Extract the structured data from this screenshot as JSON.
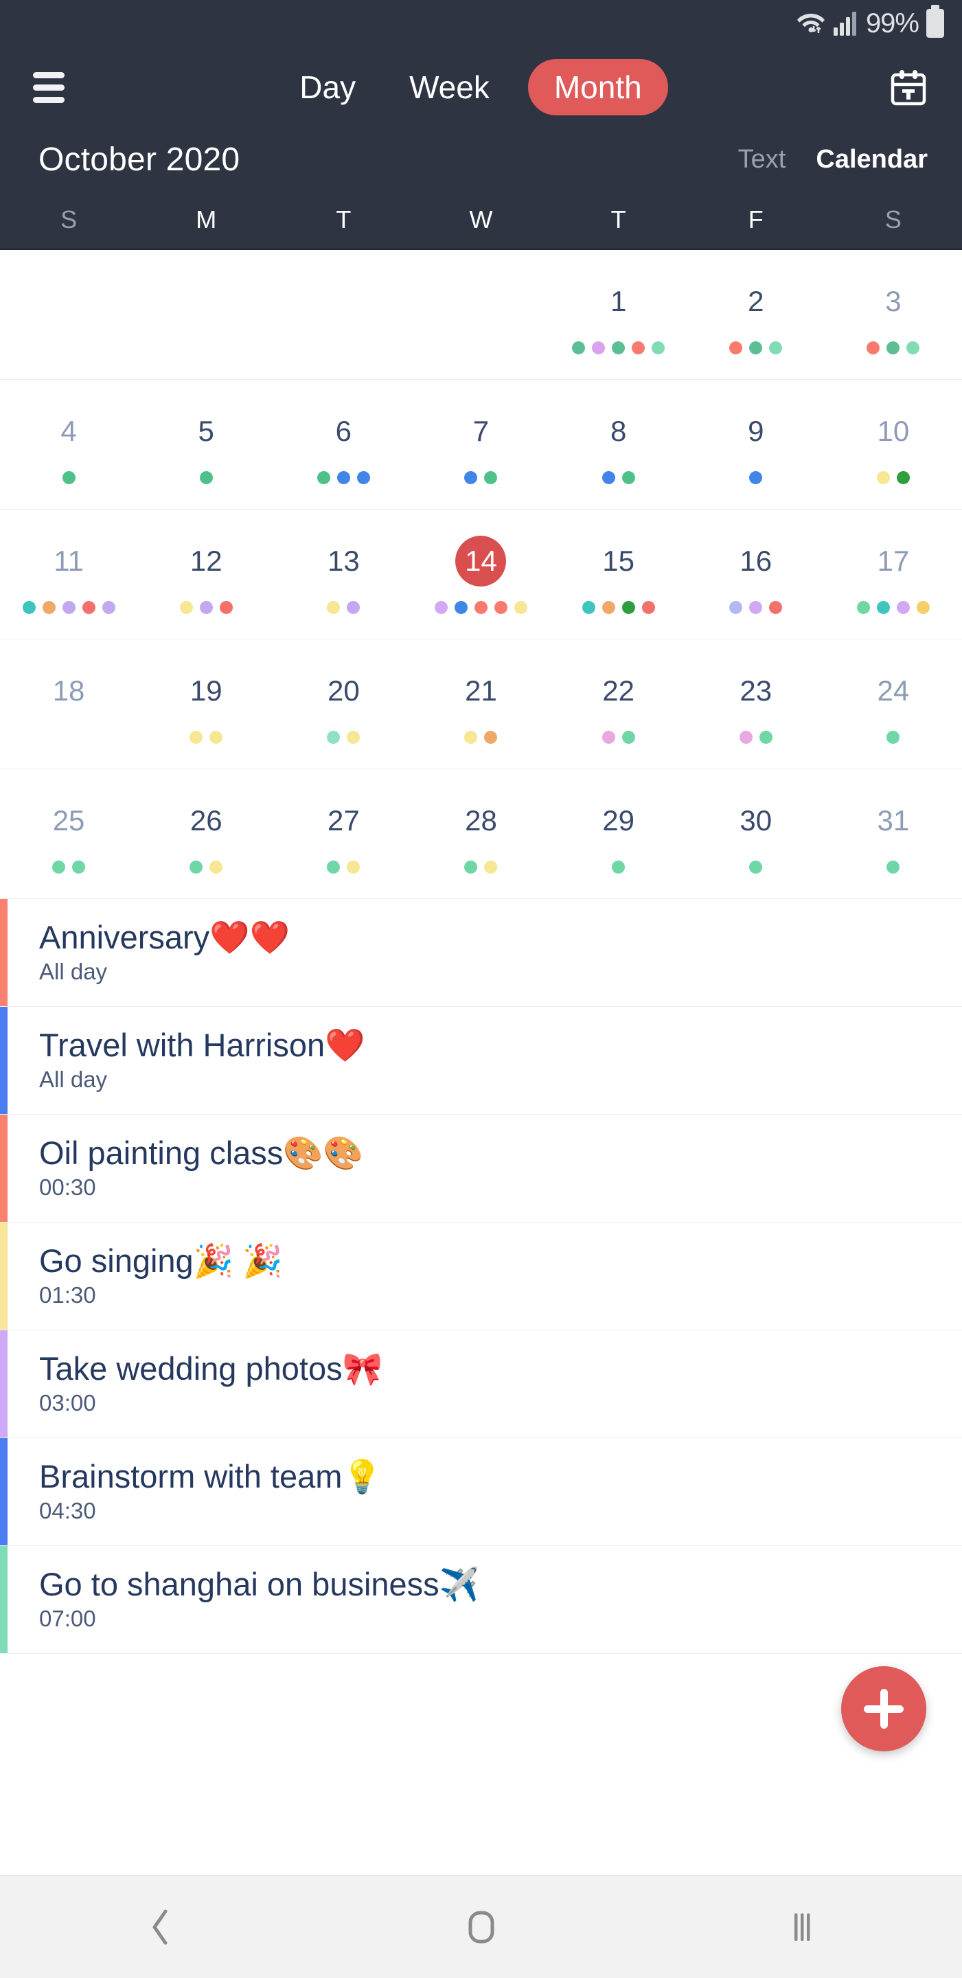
{
  "status_bar": {
    "wifi_icon": "wifi-icon",
    "signal_icon": "cellular-signal-icon",
    "battery_percent": "99%",
    "battery_icon": "battery-full-icon"
  },
  "app_bar": {
    "menu_icon": "hamburger-menu-icon",
    "today_icon": "calendar-today-icon",
    "view_tabs": [
      {
        "label": "Day",
        "active": false
      },
      {
        "label": "Week",
        "active": false
      },
      {
        "label": "Month",
        "active": true
      }
    ]
  },
  "header": {
    "month_title": "October 2020",
    "mode_text_label": "Text",
    "mode_calendar_label": "Calendar",
    "accent_color": "#e05a5a",
    "header_bg": "#2e3442"
  },
  "weekdays": [
    {
      "label": "S",
      "weekend": true
    },
    {
      "label": "M",
      "weekend": false
    },
    {
      "label": "T",
      "weekend": false
    },
    {
      "label": "W",
      "weekend": false
    },
    {
      "label": "T",
      "weekend": false
    },
    {
      "label": "F",
      "weekend": false
    },
    {
      "label": "S",
      "weekend": true
    }
  ],
  "calendar": {
    "today": "14",
    "weeks": [
      [
        {
          "num": "",
          "dim": false,
          "today": false,
          "dots": []
        },
        {
          "num": "",
          "dim": false,
          "today": false,
          "dots": []
        },
        {
          "num": "",
          "dim": false,
          "today": false,
          "dots": []
        },
        {
          "num": "",
          "dim": false,
          "today": false,
          "dots": []
        },
        {
          "num": "1",
          "dim": false,
          "today": false,
          "dots": [
            "#5cbd96",
            "#d9a3f0",
            "#5cbd96",
            "#f97a6d",
            "#7fdcb4"
          ]
        },
        {
          "num": "2",
          "dim": false,
          "today": false,
          "dots": [
            "#f97a6d",
            "#5cbd96",
            "#7fdcb4"
          ]
        },
        {
          "num": "3",
          "dim": true,
          "today": false,
          "dots": [
            "#f97a6d",
            "#5cbd96",
            "#7fdcb4"
          ]
        }
      ],
      [
        {
          "num": "4",
          "dim": true,
          "today": false,
          "dots": [
            "#4ec08a"
          ]
        },
        {
          "num": "5",
          "dim": false,
          "today": false,
          "dots": [
            "#4ec08a"
          ]
        },
        {
          "num": "6",
          "dim": false,
          "today": false,
          "dots": [
            "#4ec08a",
            "#4285e8",
            "#4285e8"
          ]
        },
        {
          "num": "7",
          "dim": false,
          "today": false,
          "dots": [
            "#4285e8",
            "#4ec08a"
          ]
        },
        {
          "num": "8",
          "dim": false,
          "today": false,
          "dots": [
            "#4285e8",
            "#4ec08a"
          ]
        },
        {
          "num": "9",
          "dim": false,
          "today": false,
          "dots": [
            "#4285e8"
          ]
        },
        {
          "num": "10",
          "dim": true,
          "today": false,
          "dots": [
            "#f7e694",
            "#2e9e3e"
          ]
        }
      ],
      [
        {
          "num": "11",
          "dim": true,
          "today": false,
          "dots": [
            "#3fc4bf",
            "#f0a868",
            "#c2a8f0",
            "#f4706a",
            "#c2a8f0"
          ]
        },
        {
          "num": "12",
          "dim": false,
          "today": false,
          "dots": [
            "#f7e694",
            "#c2a8f0",
            "#f4706a"
          ]
        },
        {
          "num": "13",
          "dim": false,
          "today": false,
          "dots": [
            "#f7e694",
            "#c2a8f0"
          ]
        },
        {
          "num": "14",
          "dim": false,
          "today": true,
          "dots": [
            "#d2a8f5",
            "#4285e8",
            "#f97a6d",
            "#f97a6d",
            "#f7e694"
          ]
        },
        {
          "num": "15",
          "dim": false,
          "today": false,
          "dots": [
            "#3fc4bf",
            "#f0a868",
            "#2e9e3e",
            "#f4706a"
          ]
        },
        {
          "num": "16",
          "dim": false,
          "today": false,
          "dots": [
            "#b3b9f0",
            "#d2a8f5",
            "#f4706a"
          ]
        },
        {
          "num": "17",
          "dim": true,
          "today": false,
          "dots": [
            "#6fd6a6",
            "#3fc4bf",
            "#d2a8f5",
            "#f4cf6a"
          ]
        }
      ],
      [
        {
          "num": "18",
          "dim": true,
          "today": false,
          "dots": []
        },
        {
          "num": "19",
          "dim": false,
          "today": false,
          "dots": [
            "#f7e694",
            "#f7e694"
          ]
        },
        {
          "num": "20",
          "dim": false,
          "today": false,
          "dots": [
            "#8fe0c4",
            "#f7e694"
          ]
        },
        {
          "num": "21",
          "dim": false,
          "today": false,
          "dots": [
            "#f7e694",
            "#f0a868"
          ]
        },
        {
          "num": "22",
          "dim": false,
          "today": false,
          "dots": [
            "#e9a8e0",
            "#6fd6a6"
          ]
        },
        {
          "num": "23",
          "dim": false,
          "today": false,
          "dots": [
            "#e9a8e0",
            "#6fd6a6"
          ]
        },
        {
          "num": "24",
          "dim": true,
          "today": false,
          "dots": [
            "#6fd6a6"
          ]
        }
      ],
      [
        {
          "num": "25",
          "dim": true,
          "today": false,
          "dots": [
            "#6fd6a6",
            "#6fd6a6"
          ]
        },
        {
          "num": "26",
          "dim": false,
          "today": false,
          "dots": [
            "#6fd6a6",
            "#f7e694"
          ]
        },
        {
          "num": "27",
          "dim": false,
          "today": false,
          "dots": [
            "#6fd6a6",
            "#f7e694"
          ]
        },
        {
          "num": "28",
          "dim": false,
          "today": false,
          "dots": [
            "#6fd6a6",
            "#f7e694"
          ]
        },
        {
          "num": "29",
          "dim": false,
          "today": false,
          "dots": [
            "#6fd6a6"
          ]
        },
        {
          "num": "30",
          "dim": false,
          "today": false,
          "dots": [
            "#6fd6a6"
          ]
        },
        {
          "num": "31",
          "dim": true,
          "today": false,
          "dots": [
            "#6fd6a6"
          ]
        }
      ]
    ]
  },
  "events": [
    {
      "title": "Anniversary❤️❤️",
      "time": "All day",
      "color": "#f9816f"
    },
    {
      "title": "Travel with Harrison❤️",
      "time": "All day",
      "color": "#4a7df0"
    },
    {
      "title": "Oil painting class🎨🎨",
      "time": "00:30",
      "color": "#f9816f"
    },
    {
      "title": "Go singing🎉 🎉",
      "time": "01:30",
      "color": "#f7e59a"
    },
    {
      "title": "Take wedding photos🎀",
      "time": "03:00",
      "color": "#cfa8f7"
    },
    {
      "title": "Brainstorm with team💡",
      "time": "04:30",
      "color": "#4a7df0"
    },
    {
      "title": "Go to shanghai on business✈️",
      "time": "07:00",
      "color": "#7fdcb4"
    }
  ],
  "fab": {
    "icon": "plus-icon",
    "color": "#e05a5a"
  },
  "nav_bar": {
    "back_icon": "back-chevron-icon",
    "home_icon": "home-square-icon",
    "recents_icon": "recent-apps-icon"
  }
}
